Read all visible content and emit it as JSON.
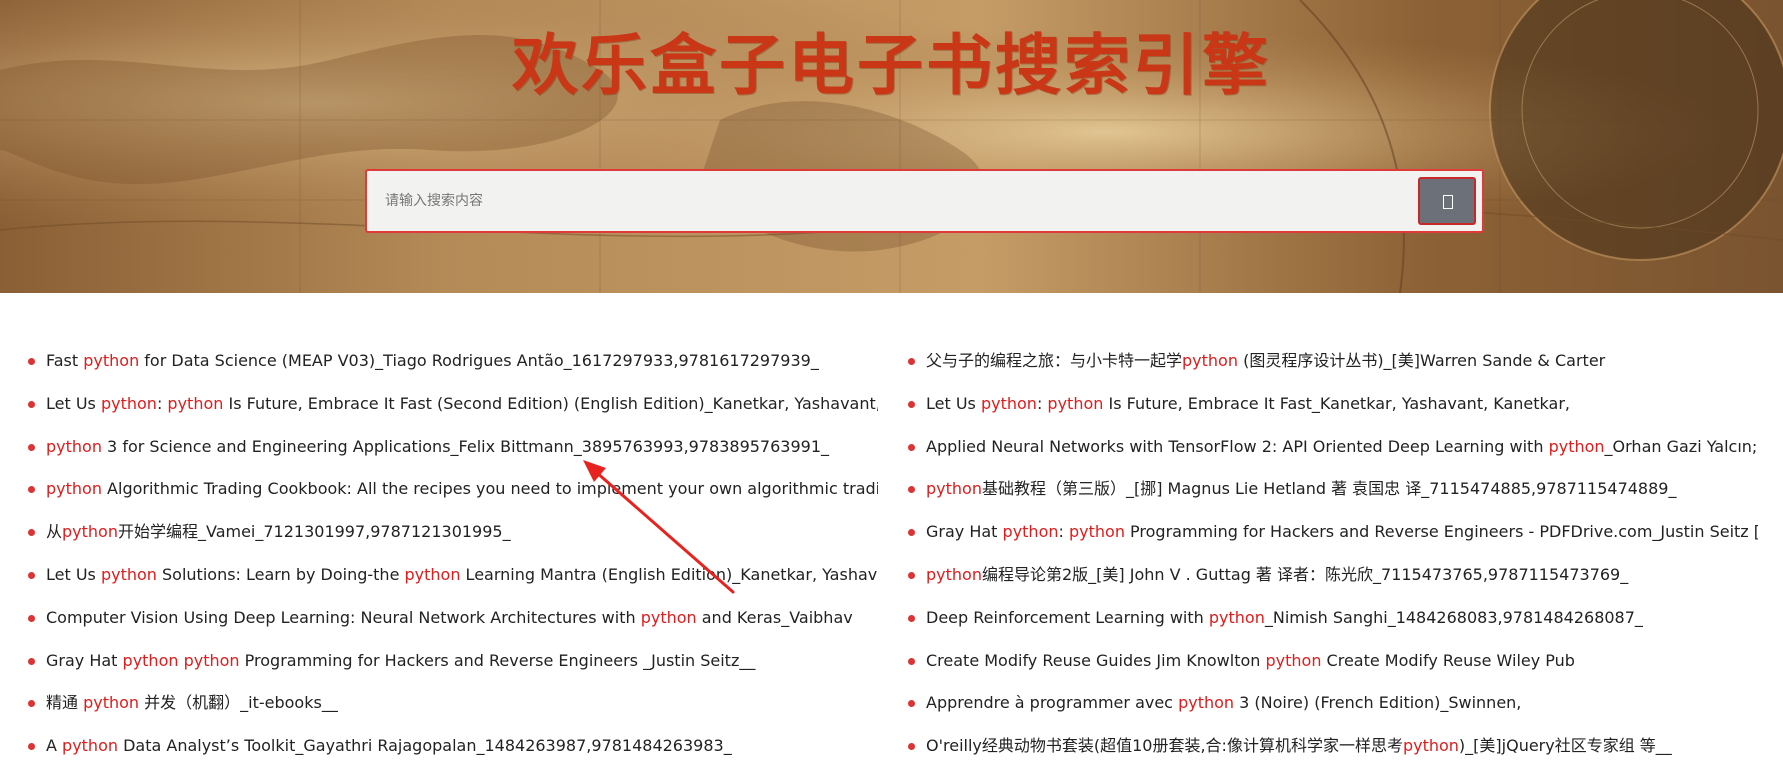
{
  "header": {
    "title": "欢乐盒子电子书搜索引擎"
  },
  "search": {
    "placeholder": "请输入搜索内容",
    "value": "",
    "button_icon": "search-icon"
  },
  "keyword": "python",
  "colors": {
    "title": "#c93717",
    "highlight": "#e31b1b",
    "bullet": "#dd3333",
    "search_border": "#e03a3a",
    "button_bg": "#6c7179",
    "annotation_arrow": "#e8231f"
  },
  "results": {
    "left": [
      "Fast python for Data Science (MEAP V03)_Tiago Rodrigues Antão_1617297933,9781617297939_",
      "Let Us python: python Is Future, Embrace It Fast (Second Edition) (English Edition)_Kanetkar, Yashavant,",
      "python 3 for Science and Engineering Applications_Felix Bittmann_3895763993,9783895763991_",
      "python Algorithmic Trading Cookbook: All the recipes you need to implement your own algorithmic trading",
      "从python开始学编程_Vamei_7121301997,9787121301995_",
      "Let Us python Solutions: Learn by Doing-the python Learning Mantra (English Edition)_Kanetkar, Yashavant,",
      "Computer Vision Using Deep Learning: Neural Network Architectures with python and Keras_Vaibhav",
      "Gray Hat python python Programming for Hackers and Reverse Engineers _Justin Seitz__",
      "精通 python 并发（机翻）_it-ebooks__",
      "A python Data Analyst’s Toolkit_Gayathri Rajagopalan_1484263987,9781484263983_"
    ],
    "right": [
      "父与子的编程之旅：与小卡特一起学python (图灵程序设计丛书)_[美]Warren Sande & Carter",
      "Let Us python: python Is Future, Embrace It Fast_Kanetkar, Yashavant, Kanetkar,",
      "Applied Neural Networks with TensorFlow 2: API Oriented Deep Learning with python_Orhan Gazi Yalcın;",
      "python基础教程（第三版）_[挪] Magnus Lie Hetland 著 袁国忠 译_7115474885,9787115474889_",
      "Gray Hat python: python Programming for Hackers and Reverse Engineers - PDFDrive.com_Justin Seitz [Seitz,",
      "python编程导论第2版_[美] John V . Guttag 著 译者：陈光欣_7115473765,9787115473769_",
      "Deep Reinforcement Learning with python_Nimish Sanghi_1484268083,9781484268087_",
      "Create Modify Reuse Guides Jim Knowlton python Create Modify Reuse Wiley Pub",
      "Apprendre à programmer avec python 3 (Noire) (French Edition)_Swinnen,",
      "O'reilly经典动物书套装(超值10册套装,合:像计算机科学家一样思考python)_[美]jQuery社区专家组 等__"
    ]
  }
}
